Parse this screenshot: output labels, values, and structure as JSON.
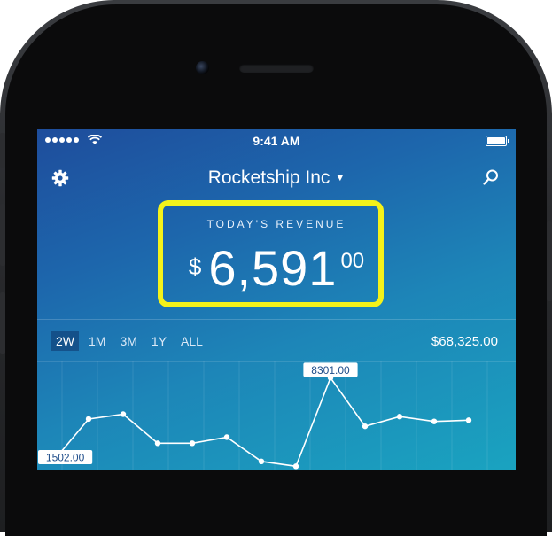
{
  "status_bar": {
    "time": "9:41 AM"
  },
  "header": {
    "company": "Rocketship Inc",
    "caret": "▼"
  },
  "revenue": {
    "label": "TODAY'S REVENUE",
    "currency": "$",
    "amount": "6,591",
    "cents": "00"
  },
  "ranges": [
    {
      "label": "2W",
      "active": true
    },
    {
      "label": "1M",
      "active": false
    },
    {
      "label": "3M",
      "active": false
    },
    {
      "label": "1Y",
      "active": false
    },
    {
      "label": "ALL",
      "active": false
    }
  ],
  "total": "$68,325.00",
  "chart_data": {
    "type": "line",
    "series": [
      {
        "values": [
          1502.0,
          4900,
          5300,
          2900,
          2900,
          3400,
          1400,
          1000,
          8301.0,
          4300,
          5100,
          4700,
          4800
        ]
      }
    ],
    "labels": [
      {
        "index": 0,
        "text": "1502.00"
      },
      {
        "index": 8,
        "text": "8301.00"
      }
    ],
    "ylim": [
      0,
      9500
    ],
    "grid": true
  },
  "colors": {
    "highlight": "#f4f21a",
    "gradient_start": "#1e4d9c",
    "gradient_end": "#1aa3c0"
  }
}
